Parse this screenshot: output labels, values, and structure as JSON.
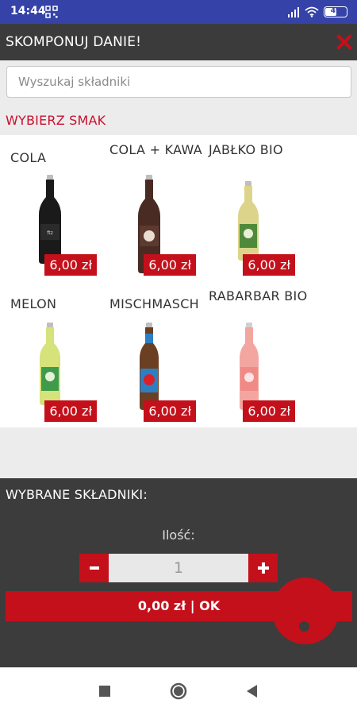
{
  "status_bar": {
    "time": "14:44",
    "battery": "49",
    "left_icon": "qr-code-icon",
    "right_icons": [
      "signal-icon",
      "wifi-icon",
      "battery-icon"
    ]
  },
  "header": {
    "title": "SKOMPONUJ DANIE!",
    "close_icon": "close-icon"
  },
  "search": {
    "placeholder": "Wyszukaj składniki",
    "value": ""
  },
  "flavor_section": {
    "title": "WYBIERZ SMAK"
  },
  "products": [
    {
      "name": "COLA",
      "price": "6,00 zł",
      "icon": "cola-bottle"
    },
    {
      "name": "COLA + KAWA",
      "price": "6,00 zł",
      "icon": "cola-kawa-bottle"
    },
    {
      "name": "JABŁKO BIO",
      "price": "6,00 zł",
      "icon": "apple-bottle"
    },
    {
      "name": "MELON",
      "price": "6,00 zł",
      "icon": "melon-bottle"
    },
    {
      "name": "MISCHMASCH",
      "price": "6,00 zł",
      "icon": "mischmasch-bottle"
    },
    {
      "name": "RABARBAR BIO",
      "price": "6,00 zł",
      "icon": "rhubarb-bottle"
    }
  ],
  "selected": {
    "title": "WYBRANE SKŁADNIKI:",
    "quantity_label": "Ilość:",
    "quantity": "1",
    "ok_label": "0,00 zł | OK"
  },
  "colors": {
    "accent_red": "#c4101b",
    "header_dark": "#3b3b3b",
    "status_blue": "#3542a8"
  },
  "nav": {
    "icons": [
      "recents-icon",
      "home-icon",
      "back-icon"
    ]
  }
}
